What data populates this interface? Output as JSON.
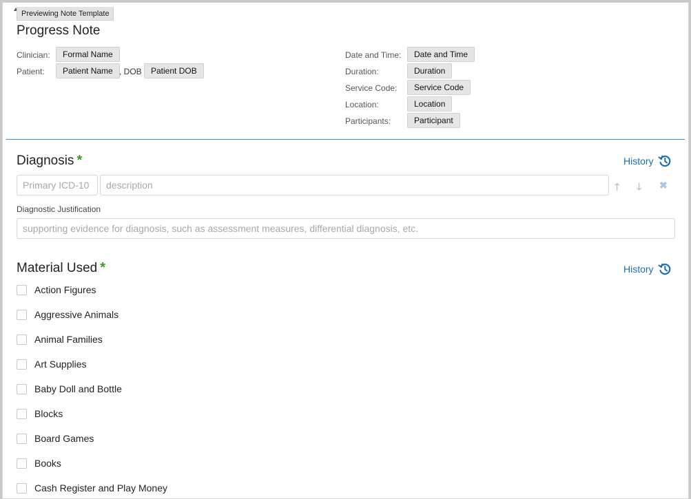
{
  "preview_tab": "Previewing Note Template",
  "title": "Progress Note",
  "header": {
    "clinician_label": "Clinician:",
    "clinician_value": "Formal Name",
    "patient_label": "Patient:",
    "patient_value": "Patient Name",
    "dob_text": ", DOB",
    "patient_dob_value": "Patient DOB",
    "datetime_label": "Date and Time:",
    "datetime_value": "Date and Time",
    "duration_label": "Duration:",
    "duration_value": "Duration",
    "service_code_label": "Service Code:",
    "service_code_value": "Service Code",
    "location_label": "Location:",
    "location_value": "Location",
    "participants_label": "Participants:",
    "participants_value": "Participant"
  },
  "diagnosis": {
    "title": "Diagnosis",
    "required_mark": "*",
    "history_label": "History",
    "icd_placeholder": "Primary ICD-10",
    "description_placeholder": "description",
    "justification_label": "Diagnostic Justification",
    "justification_placeholder": "supporting evidence for diagnosis, such as assessment measures, differential diagnosis, etc."
  },
  "material": {
    "title": "Material Used",
    "required_mark": "*",
    "history_label": "History",
    "items": [
      "Action Figures",
      "Aggressive Animals",
      "Animal Families",
      "Art Supplies",
      "Baby Doll and Bottle",
      "Blocks",
      "Board Games",
      "Books",
      "Cash Register and Play Money"
    ]
  },
  "colors": {
    "accent": "#1a6fa8",
    "required": "#3e9a2a",
    "divider": "#3b8fc4"
  }
}
